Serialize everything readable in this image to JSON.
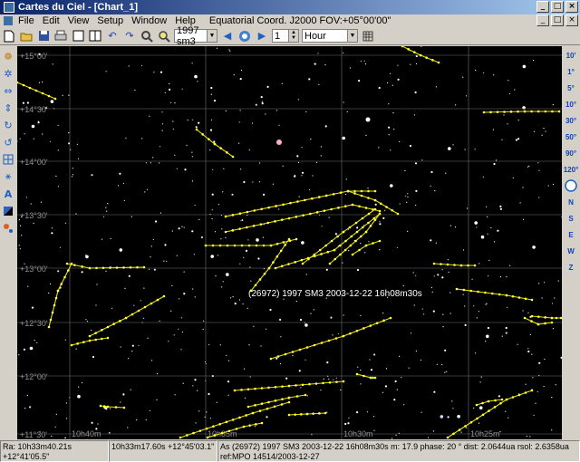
{
  "window": {
    "title": "Cartes du Ciel - [Chart_1]",
    "btn_min": "_",
    "btn_max": "□",
    "btn_close": "×",
    "inner_min": "_",
    "inner_max": "□",
    "inner_close": "×"
  },
  "menu": {
    "items": [
      "File",
      "Edit",
      "View",
      "Setup",
      "Window",
      "Help"
    ],
    "info": "Equatorial Coord. J2000 FOV:+05°00'00\""
  },
  "toolbar": {
    "object_select": "1997 sm3",
    "step_value": "1",
    "unit_select": "Hour"
  },
  "right_toolbar": {
    "fov_labels": [
      "10'",
      "1°",
      "5°",
      "10°",
      "30°",
      "50°",
      "90°",
      "120°"
    ],
    "directions": [
      "N",
      "S",
      "E",
      "W",
      "Z"
    ]
  },
  "chart": {
    "dec_labels": [
      "+15°00'",
      "+14°30'",
      "+14°00'",
      "+13°30'",
      "+13°00'",
      "+12°30'",
      "+12°00'",
      "+11°30'"
    ],
    "ra_labels": [
      "10h40m",
      "10h35m",
      "10h30m",
      "10h25m"
    ],
    "object_label": "(26972) 1997 SM3 2003-12-22 16h08m30s"
  },
  "status": {
    "coords": "Ra: 10h33m40.21s +12°41'05.5\"",
    "object_coords": "10h33m17.60s +12°45'03.1\"",
    "description": "As (26972) 1997 SM3 2003-12-22 16h08m30s m: 17.9 phase:  20 ° dist: 2.0644ua rsol: 2.6358ua ref:MPO 14514/2003-12-27"
  }
}
